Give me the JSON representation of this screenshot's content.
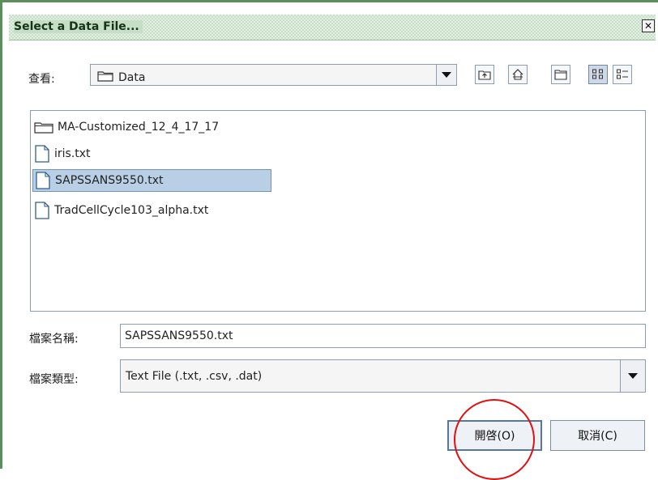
{
  "dialog": {
    "title": "Select a Data File..."
  },
  "look_in": {
    "label": "查看:",
    "value": "Data"
  },
  "toolbar": {
    "buttons": [
      {
        "icon": "up-one-level-icon"
      },
      {
        "icon": "home-icon"
      },
      {
        "icon": "new-folder-icon"
      },
      {
        "icon": "list-view-icon",
        "selected": true
      },
      {
        "icon": "details-view-icon"
      }
    ]
  },
  "files": [
    {
      "name": "MA-Customized_12_4_17_17",
      "type": "folder"
    },
    {
      "name": "iris.txt",
      "type": "file"
    },
    {
      "name": "SAPSSANS9550.txt",
      "type": "file",
      "selected": true
    },
    {
      "name": "TradCellCycle103_alpha.txt",
      "type": "file"
    }
  ],
  "filename": {
    "label": "檔案名稱:",
    "value": "SAPSSANS9550.txt"
  },
  "filetype": {
    "label": "檔案類型:",
    "value": "Text File (.txt, .csv, .dat)"
  },
  "buttons": {
    "open": "開啓(O)",
    "cancel": "取消(C)"
  },
  "colors": {
    "frame": "#5a8f5a",
    "titlebar": "#c6dec6",
    "selection": "#b8cfe5",
    "highlight_ring": "#e01010"
  }
}
